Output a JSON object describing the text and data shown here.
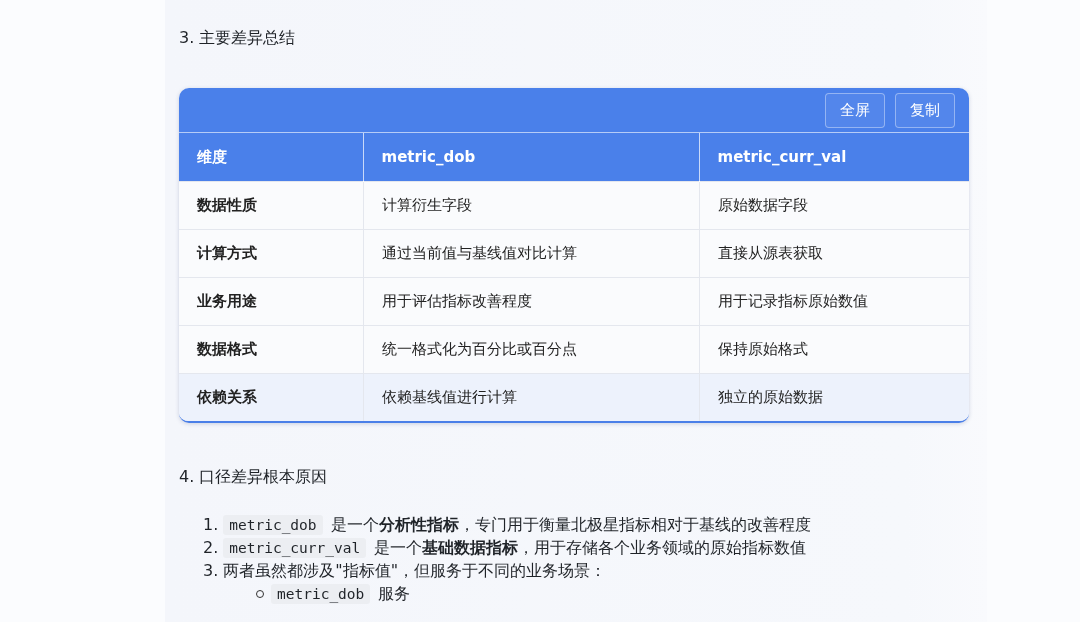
{
  "section_3": {
    "heading": "3. 主要差异总结"
  },
  "table": {
    "toolbar_buttons": [
      "全屏",
      "复制"
    ],
    "columns": [
      "维度",
      "metric_dob",
      "metric_curr_val"
    ],
    "rows": [
      {
        "cells": [
          "数据性质",
          "计算衍生字段",
          "原始数据字段"
        ],
        "hovered": false
      },
      {
        "cells": [
          "计算方式",
          "通过当前值与基线值对比计算",
          "直接从源表获取"
        ],
        "hovered": false
      },
      {
        "cells": [
          "业务用途",
          "用于评估指标改善程度",
          "用于记录指标原始数值"
        ],
        "hovered": false
      },
      {
        "cells": [
          "数据格式",
          "统一格式化为百分比或百分点",
          "保持原始格式"
        ],
        "hovered": false
      },
      {
        "cells": [
          "依赖关系",
          "依赖基线值进行计算",
          "独立的原始数据"
        ],
        "hovered": true
      }
    ]
  },
  "section_4": {
    "heading": "4. 口径差异根本原因",
    "items": [
      {
        "number": "1.",
        "code": "metric_dob",
        "text": "是一个**分析性指标**，专门用于衡量北极星指标相对于基线的改善程度"
      },
      {
        "number": "2.",
        "code": "metric_curr_val",
        "text": "是一个**基础数据指标**，用于存储各个业务领域的原始指标数值"
      },
      {
        "number": "3.",
        "text": "两者虽然都涉及\"指标值\"，但服务于不同的业务场景：",
        "children": [
          {
            "code": "metric_dob",
            "text": "服务"
          }
        ]
      }
    ]
  }
}
